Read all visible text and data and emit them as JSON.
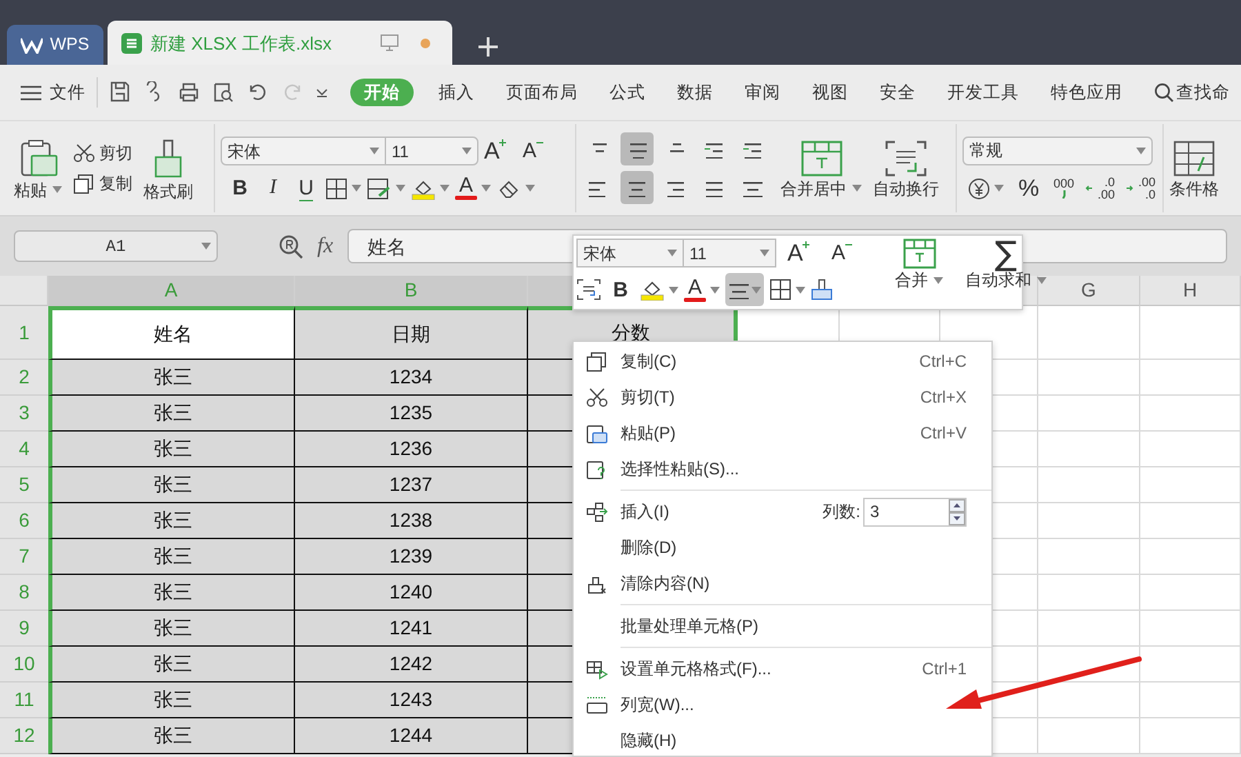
{
  "tabs": [
    {
      "label": "WPS",
      "kind": "app",
      "selected": false
    },
    {
      "label": "新建 XLSX 工作表.xlsx",
      "kind": "document",
      "selected": true,
      "unsaved": true
    }
  ],
  "menu_bar": {
    "file": "文件",
    "quick_access": [
      {
        "disabled": false
      },
      {
        "disabled": false
      },
      {
        "disabled": false
      },
      {
        "disabled": false
      },
      {
        "disabled": false
      },
      {
        "disabled": true
      }
    ],
    "tabs": [
      {
        "label": "开始",
        "selected": true
      },
      {
        "label": "插入",
        "selected": false
      },
      {
        "label": "页面布局",
        "selected": false
      },
      {
        "label": "公式",
        "selected": false
      },
      {
        "label": "数据",
        "selected": false
      },
      {
        "label": "审阅",
        "selected": false
      },
      {
        "label": "视图",
        "selected": false
      },
      {
        "label": "安全",
        "selected": false
      },
      {
        "label": "开发工具",
        "selected": false
      },
      {
        "label": "特色应用",
        "selected": false
      }
    ],
    "search": "查找命"
  },
  "ribbon": {
    "paste": "粘贴",
    "cut": "剪切",
    "copy": "复制",
    "format_painter": "格式刷",
    "font": "宋体",
    "font_size": "11",
    "grow": "A",
    "shrink": "A",
    "bold": "B",
    "italic": "I",
    "underline": "U",
    "font_color": "A",
    "align_buttons": [
      {
        "selected": false
      },
      {
        "selected": true
      },
      {
        "selected": false
      },
      {
        "selected": false
      },
      {
        "selected": false
      },
      {
        "selected": false
      },
      {
        "selected": true
      },
      {
        "selected": false
      },
      {
        "selected": false
      },
      {
        "selected": false
      }
    ],
    "merge_center": "合并居中",
    "wrap_text": "自动换行",
    "number_format": "常规",
    "percent": "%",
    "thousands": "000",
    "decimal_buttons": [
      {
        "top": ".0",
        "bottom": ".00"
      },
      {
        "top": ".00",
        "bottom": ".0"
      }
    ],
    "conditional_format": "条件格"
  },
  "formula_bar": {
    "name_box": "A1",
    "fx": "fx",
    "value": "姓名"
  },
  "sheet": {
    "columns": [
      {
        "label": "A",
        "selected": true
      },
      {
        "label": "B",
        "selected": true
      },
      {
        "selected": true
      },
      {},
      {},
      {
        "selected": false
      },
      {
        "label": "G",
        "selected": false
      },
      {
        "label": "H",
        "selected": false
      }
    ],
    "rows": [
      {
        "header": "1",
        "selected": true,
        "cells": [
          {
            "text": "姓名",
            "active": true
          },
          {
            "text": "日期",
            "active": false
          },
          {
            "text": "分数",
            "active": false
          }
        ]
      },
      {
        "header": "2",
        "selected": true,
        "cells": [
          {
            "text": "张三",
            "active": false
          },
          {
            "text": "1234",
            "active": false
          }
        ]
      },
      {
        "header": "3",
        "selected": true,
        "cells": [
          {
            "text": "张三",
            "active": false
          },
          {
            "text": "1235",
            "active": false
          }
        ]
      },
      {
        "header": "4",
        "selected": true,
        "cells": [
          {
            "text": "张三",
            "active": false
          },
          {
            "text": "1236",
            "active": false
          }
        ]
      },
      {
        "header": "5",
        "selected": true,
        "cells": [
          {
            "text": "张三",
            "active": false
          },
          {
            "text": "1237",
            "active": false
          }
        ]
      },
      {
        "header": "6",
        "selected": true,
        "cells": [
          {
            "text": "张三",
            "active": false
          },
          {
            "text": "1238",
            "active": false
          }
        ]
      },
      {
        "header": "7",
        "selected": true,
        "cells": [
          {
            "text": "张三",
            "active": false
          },
          {
            "text": "1239",
            "active": false
          }
        ]
      },
      {
        "header": "8",
        "selected": true,
        "cells": [
          {
            "text": "张三",
            "active": false
          },
          {
            "text": "1240",
            "active": false
          }
        ]
      },
      {
        "header": "9",
        "selected": true,
        "cells": [
          {
            "text": "张三",
            "active": false
          },
          {
            "text": "1241",
            "active": false
          }
        ]
      },
      {
        "header": "10",
        "selected": true,
        "cells": [
          {
            "text": "张三",
            "active": false
          },
          {
            "text": "1242",
            "active": false
          }
        ]
      },
      {
        "header": "11",
        "selected": true,
        "cells": [
          {
            "text": "张三",
            "active": false
          },
          {
            "text": "1243",
            "active": false
          }
        ]
      },
      {
        "header": "12",
        "selected": true,
        "cells": [
          {
            "text": "张三",
            "active": false
          },
          {
            "text": "1244",
            "active": false
          }
        ]
      }
    ]
  },
  "mini_toolbar": {
    "font": "宋体",
    "font_size": "11",
    "grow": "A",
    "shrink": "A",
    "bold": "B",
    "font_color": "A",
    "align_selected": true,
    "merge": "合并",
    "sum": "∑",
    "autosum": "自动求和"
  },
  "context_menu": [
    {
      "kind": "item",
      "label": "复制(C)",
      "shortcut": "Ctrl+C"
    },
    {
      "kind": "item",
      "label": "剪切(T)",
      "shortcut": "Ctrl+X"
    },
    {
      "kind": "item",
      "label": "粘贴(P)",
      "shortcut": "Ctrl+V"
    },
    {
      "kind": "item",
      "label": "选择性粘贴(S)..."
    },
    {
      "kind": "separator"
    },
    {
      "kind": "insert",
      "label": "插入(I)",
      "count_label": "列数:",
      "count": "3"
    },
    {
      "kind": "item",
      "label": "删除(D)"
    },
    {
      "kind": "item",
      "label": "清除内容(N)"
    },
    {
      "kind": "separator"
    },
    {
      "kind": "item",
      "label": "批量处理单元格(P)"
    },
    {
      "kind": "separator"
    },
    {
      "kind": "item",
      "label": "设置单元格格式(F)...",
      "shortcut": "Ctrl+1"
    },
    {
      "kind": "item",
      "label": "列宽(W)..."
    },
    {
      "kind": "item",
      "label": "隐藏(H)"
    }
  ]
}
